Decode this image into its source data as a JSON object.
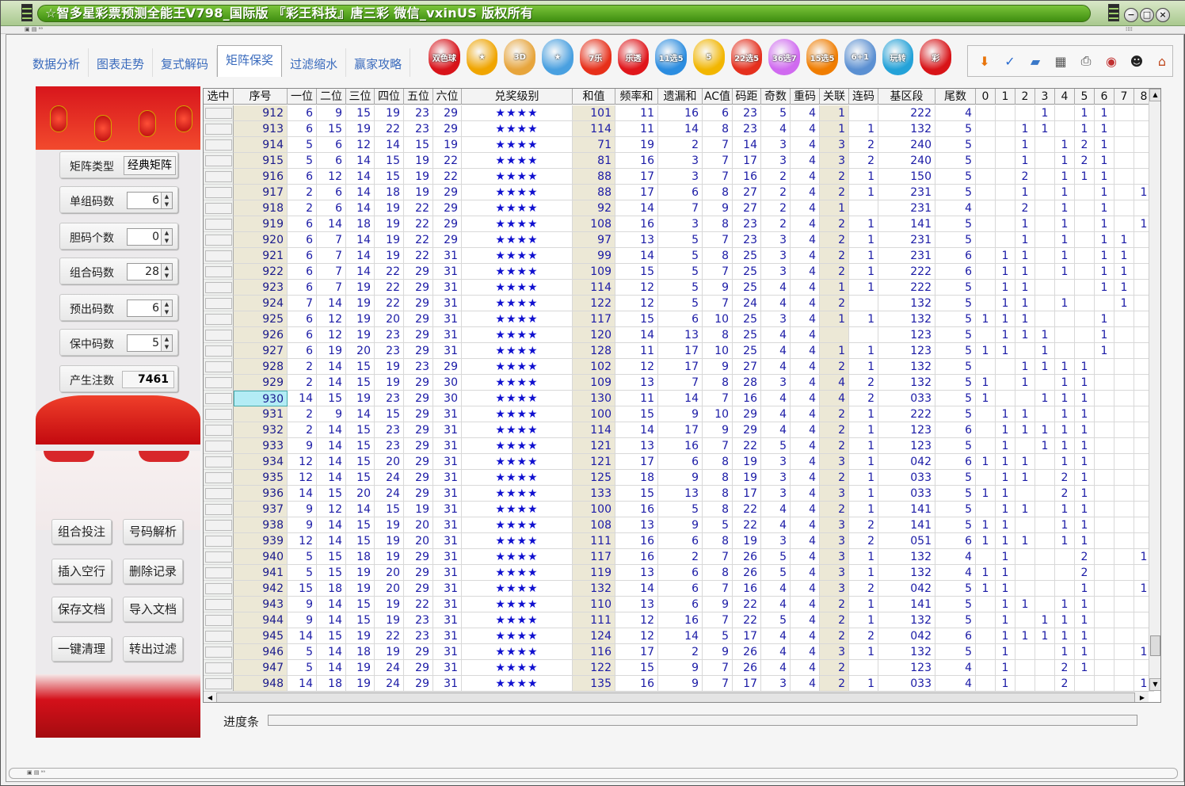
{
  "window": {
    "title": "☆智多星彩票预测全能王V798_国际版 『彩王科技』唐三彩 微信_vxinUS 版权所有",
    "min": "−",
    "max": "□",
    "close": "×",
    "mini_left": "▣ ▤ ᵃᵃ",
    "mini_right": "⁞⁞⁞⁞"
  },
  "tabs": [
    {
      "label": "数据分析"
    },
    {
      "label": "图表走势"
    },
    {
      "label": "复式解码"
    },
    {
      "label": "矩阵保奖",
      "active": true
    },
    {
      "label": "过滤缩水"
    },
    {
      "label": "赢家攻略"
    }
  ],
  "lottery_icons": [
    {
      "name": "shuangseqiu",
      "text": "双色球",
      "color": "#d8131a"
    },
    {
      "name": "qixingcai",
      "text": "★",
      "color": "#f0a500"
    },
    {
      "name": "fucai3d",
      "text": "3D",
      "color": "#e7a53c"
    },
    {
      "name": "pailie",
      "text": "★",
      "color": "#49a0e0"
    },
    {
      "name": "qilecai",
      "text": "7乐",
      "color": "#e7301a"
    },
    {
      "name": "daletou",
      "text": "乐透",
      "color": "#e0161b"
    },
    {
      "name": "11xuan5",
      "text": "11选5",
      "color": "#2c8de0"
    },
    {
      "name": "haocai5",
      "text": "5",
      "color": "#f2b600"
    },
    {
      "name": "22xuan5",
      "text": "22选5",
      "color": "#e5301e"
    },
    {
      "name": "36xuan7",
      "text": "36选7",
      "color": "#d06af0"
    },
    {
      "name": "15xuan5",
      "text": "15选5",
      "color": "#f07d00"
    },
    {
      "name": "6plus1",
      "text": "6+1",
      "color": "#5b90d2"
    },
    {
      "name": "huanle",
      "text": "玩转",
      "color": "#24a2d8"
    },
    {
      "name": "extra",
      "text": "彩",
      "color": "#d81418"
    }
  ],
  "tools": [
    "down-arrow",
    "abc-check",
    "save-folder",
    "calculator",
    "printer",
    "gumball",
    "qq-penguin",
    "home"
  ],
  "tool_glyphs": [
    "⬇",
    "✓",
    "▰",
    "▦",
    "⎙",
    "◉",
    "☻",
    "⌂"
  ],
  "left": {
    "matrix_type_label": "矩阵类型",
    "matrix_type_value": "经典矩阵",
    "group_count_label": "单组码数",
    "group_count_value": "6",
    "dan_count_label": "胆码个数",
    "dan_count_value": "0",
    "combo_count_label": "组合码数",
    "combo_count_value": "28",
    "predict_label": "预出码数",
    "predict_value": "6",
    "guarantee_label": "保中码数",
    "guarantee_value": "5",
    "output_label": "产生注数",
    "output_value": "7461",
    "buttons": [
      "组合投注",
      "号码解析",
      "插入空行",
      "删除记录",
      "保存文档",
      "导入文档",
      "一键清理",
      "转出过滤"
    ]
  },
  "grid": {
    "headers": [
      "选中",
      "序号",
      "一位",
      "二位",
      "三位",
      "四位",
      "五位",
      "六位",
      "兑奖级别",
      "和值",
      "频率和",
      "遗漏和",
      "AC值",
      "码距",
      "奇数",
      "重码",
      "关联",
      "连码",
      "基区段",
      "尾数",
      "0",
      "1",
      "2",
      "3",
      "4",
      "5",
      "6",
      "7",
      "8"
    ],
    "stars": "★★★★",
    "highlight_seq": "930",
    "rows": [
      [
        "912",
        "6",
        "9",
        "15",
        "19",
        "23",
        "29",
        "101",
        "11",
        "16",
        "6",
        "23",
        "5",
        "4",
        "1",
        "",
        "222",
        "4",
        "",
        "",
        "",
        "1",
        "",
        "1",
        "1",
        "",
        ""
      ],
      [
        "913",
        "6",
        "15",
        "19",
        "22",
        "23",
        "29",
        "114",
        "11",
        "14",
        "8",
        "23",
        "4",
        "4",
        "1",
        "1",
        "132",
        "5",
        "",
        "",
        "1",
        "1",
        "",
        "1",
        "1",
        "",
        ""
      ],
      [
        "914",
        "5",
        "6",
        "12",
        "14",
        "15",
        "19",
        "71",
        "19",
        "2",
        "7",
        "14",
        "3",
        "4",
        "3",
        "2",
        "240",
        "5",
        "",
        "",
        "1",
        "",
        "1",
        "2",
        "1",
        "",
        ""
      ],
      [
        "915",
        "5",
        "6",
        "14",
        "15",
        "19",
        "22",
        "81",
        "16",
        "3",
        "7",
        "17",
        "3",
        "4",
        "3",
        "2",
        "240",
        "5",
        "",
        "",
        "1",
        "",
        "1",
        "2",
        "1",
        "",
        ""
      ],
      [
        "916",
        "6",
        "12",
        "14",
        "15",
        "19",
        "22",
        "88",
        "17",
        "3",
        "7",
        "16",
        "2",
        "4",
        "2",
        "1",
        "150",
        "5",
        "",
        "",
        "2",
        "",
        "1",
        "1",
        "1",
        "",
        ""
      ],
      [
        "917",
        "2",
        "6",
        "14",
        "18",
        "19",
        "29",
        "88",
        "17",
        "6",
        "8",
        "27",
        "2",
        "4",
        "2",
        "1",
        "231",
        "5",
        "",
        "",
        "1",
        "",
        "1",
        "",
        "1",
        "",
        "1"
      ],
      [
        "918",
        "2",
        "6",
        "14",
        "19",
        "22",
        "29",
        "92",
        "14",
        "7",
        "9",
        "27",
        "2",
        "4",
        "1",
        "",
        "231",
        "4",
        "",
        "",
        "2",
        "",
        "1",
        "",
        "1",
        "",
        ""
      ],
      [
        "919",
        "6",
        "14",
        "18",
        "19",
        "22",
        "29",
        "108",
        "16",
        "3",
        "8",
        "23",
        "2",
        "4",
        "2",
        "1",
        "141",
        "5",
        "",
        "",
        "1",
        "",
        "1",
        "",
        "1",
        "",
        "1"
      ],
      [
        "920",
        "6",
        "7",
        "14",
        "19",
        "22",
        "29",
        "97",
        "13",
        "5",
        "7",
        "23",
        "3",
        "4",
        "2",
        "1",
        "231",
        "5",
        "",
        "",
        "1",
        "",
        "1",
        "",
        "1",
        "1",
        ""
      ],
      [
        "921",
        "6",
        "7",
        "14",
        "19",
        "22",
        "31",
        "99",
        "14",
        "5",
        "8",
        "25",
        "3",
        "4",
        "2",
        "1",
        "231",
        "6",
        "",
        "1",
        "1",
        "",
        "1",
        "",
        "1",
        "1",
        ""
      ],
      [
        "922",
        "6",
        "7",
        "14",
        "22",
        "29",
        "31",
        "109",
        "15",
        "5",
        "7",
        "25",
        "3",
        "4",
        "2",
        "1",
        "222",
        "6",
        "",
        "1",
        "1",
        "",
        "1",
        "",
        "1",
        "1",
        ""
      ],
      [
        "923",
        "6",
        "7",
        "19",
        "22",
        "29",
        "31",
        "114",
        "12",
        "5",
        "9",
        "25",
        "4",
        "4",
        "1",
        "1",
        "222",
        "5",
        "",
        "1",
        "1",
        "",
        "",
        "",
        "1",
        "1",
        ""
      ],
      [
        "924",
        "7",
        "14",
        "19",
        "22",
        "29",
        "31",
        "122",
        "12",
        "5",
        "7",
        "24",
        "4",
        "4",
        "2",
        "",
        "132",
        "5",
        "",
        "1",
        "1",
        "",
        "1",
        "",
        "",
        "1",
        ""
      ],
      [
        "925",
        "6",
        "12",
        "19",
        "20",
        "29",
        "31",
        "117",
        "15",
        "6",
        "10",
        "25",
        "3",
        "4",
        "1",
        "1",
        "132",
        "5",
        "1",
        "1",
        "1",
        "",
        "",
        "",
        "1",
        "",
        ""
      ],
      [
        "926",
        "6",
        "12",
        "19",
        "23",
        "29",
        "31",
        "120",
        "14",
        "13",
        "8",
        "25",
        "4",
        "4",
        "",
        "",
        "123",
        "5",
        "",
        "1",
        "1",
        "1",
        "",
        "",
        "1",
        "",
        ""
      ],
      [
        "927",
        "6",
        "19",
        "20",
        "23",
        "29",
        "31",
        "128",
        "11",
        "17",
        "10",
        "25",
        "4",
        "4",
        "1",
        "1",
        "123",
        "5",
        "1",
        "1",
        "",
        "1",
        "",
        "",
        "1",
        "",
        ""
      ],
      [
        "928",
        "2",
        "14",
        "15",
        "19",
        "23",
        "29",
        "102",
        "12",
        "17",
        "9",
        "27",
        "4",
        "4",
        "2",
        "1",
        "132",
        "5",
        "",
        "",
        "1",
        "1",
        "1",
        "1",
        "",
        "",
        ""
      ],
      [
        "929",
        "2",
        "14",
        "15",
        "19",
        "29",
        "30",
        "109",
        "13",
        "7",
        "8",
        "28",
        "3",
        "4",
        "4",
        "2",
        "132",
        "5",
        "1",
        "",
        "1",
        "",
        "1",
        "1",
        "",
        "",
        ""
      ],
      [
        "930",
        "14",
        "15",
        "19",
        "23",
        "29",
        "30",
        "130",
        "11",
        "14",
        "7",
        "16",
        "4",
        "4",
        "4",
        "2",
        "033",
        "5",
        "1",
        "",
        "",
        "1",
        "1",
        "1",
        "",
        "",
        ""
      ],
      [
        "931",
        "2",
        "9",
        "14",
        "15",
        "29",
        "31",
        "100",
        "15",
        "9",
        "10",
        "29",
        "4",
        "4",
        "2",
        "1",
        "222",
        "5",
        "",
        "1",
        "1",
        "",
        "1",
        "1",
        "",
        "",
        ""
      ],
      [
        "932",
        "2",
        "14",
        "15",
        "23",
        "29",
        "31",
        "114",
        "14",
        "17",
        "9",
        "29",
        "4",
        "4",
        "2",
        "1",
        "123",
        "6",
        "",
        "1",
        "1",
        "1",
        "1",
        "1",
        "",
        "",
        ""
      ],
      [
        "933",
        "9",
        "14",
        "15",
        "23",
        "29",
        "31",
        "121",
        "13",
        "16",
        "7",
        "22",
        "5",
        "4",
        "2",
        "1",
        "123",
        "5",
        "",
        "1",
        "",
        "1",
        "1",
        "1",
        "",
        "",
        ""
      ],
      [
        "934",
        "12",
        "14",
        "15",
        "20",
        "29",
        "31",
        "121",
        "17",
        "6",
        "8",
        "19",
        "3",
        "4",
        "3",
        "1",
        "042",
        "6",
        "1",
        "1",
        "1",
        "",
        "1",
        "1",
        "",
        "",
        ""
      ],
      [
        "935",
        "12",
        "14",
        "15",
        "24",
        "29",
        "31",
        "125",
        "18",
        "9",
        "8",
        "19",
        "3",
        "4",
        "2",
        "1",
        "033",
        "5",
        "",
        "1",
        "1",
        "",
        "2",
        "1",
        "",
        "",
        ""
      ],
      [
        "936",
        "14",
        "15",
        "20",
        "24",
        "29",
        "31",
        "133",
        "15",
        "13",
        "8",
        "17",
        "3",
        "4",
        "3",
        "1",
        "033",
        "5",
        "1",
        "1",
        "",
        "",
        "2",
        "1",
        "",
        "",
        ""
      ],
      [
        "937",
        "9",
        "12",
        "14",
        "15",
        "19",
        "31",
        "100",
        "16",
        "5",
        "8",
        "22",
        "4",
        "4",
        "2",
        "1",
        "141",
        "5",
        "",
        "1",
        "1",
        "",
        "1",
        "1",
        "",
        "",
        ""
      ],
      [
        "938",
        "9",
        "14",
        "15",
        "19",
        "20",
        "31",
        "108",
        "13",
        "9",
        "5",
        "22",
        "4",
        "4",
        "3",
        "2",
        "141",
        "5",
        "1",
        "1",
        "",
        "",
        "1",
        "1",
        "",
        "",
        ""
      ],
      [
        "939",
        "12",
        "14",
        "15",
        "19",
        "20",
        "31",
        "111",
        "16",
        "6",
        "8",
        "19",
        "3",
        "4",
        "3",
        "2",
        "051",
        "6",
        "1",
        "1",
        "1",
        "",
        "1",
        "1",
        "",
        "",
        ""
      ],
      [
        "940",
        "5",
        "15",
        "18",
        "19",
        "29",
        "31",
        "117",
        "16",
        "2",
        "7",
        "26",
        "5",
        "4",
        "3",
        "1",
        "132",
        "4",
        "",
        "1",
        "",
        "",
        "",
        "2",
        "",
        "",
        "1"
      ],
      [
        "941",
        "5",
        "15",
        "19",
        "20",
        "29",
        "31",
        "119",
        "13",
        "6",
        "8",
        "26",
        "5",
        "4",
        "3",
        "1",
        "132",
        "4",
        "1",
        "1",
        "",
        "",
        "",
        "2",
        "",
        "",
        ""
      ],
      [
        "942",
        "15",
        "18",
        "19",
        "20",
        "29",
        "31",
        "132",
        "14",
        "6",
        "7",
        "16",
        "4",
        "4",
        "3",
        "2",
        "042",
        "5",
        "1",
        "1",
        "",
        "",
        "",
        "1",
        "",
        "",
        "1"
      ],
      [
        "943",
        "9",
        "14",
        "15",
        "19",
        "22",
        "31",
        "110",
        "13",
        "6",
        "9",
        "22",
        "4",
        "4",
        "2",
        "1",
        "141",
        "5",
        "",
        "1",
        "1",
        "",
        "1",
        "1",
        "",
        "",
        ""
      ],
      [
        "944",
        "9",
        "14",
        "15",
        "19",
        "23",
        "31",
        "111",
        "12",
        "16",
        "7",
        "22",
        "5",
        "4",
        "2",
        "1",
        "132",
        "5",
        "",
        "1",
        "",
        "1",
        "1",
        "1",
        "",
        "",
        ""
      ],
      [
        "945",
        "14",
        "15",
        "19",
        "22",
        "23",
        "31",
        "124",
        "12",
        "14",
        "5",
        "17",
        "4",
        "4",
        "2",
        "2",
        "042",
        "6",
        "",
        "1",
        "1",
        "1",
        "1",
        "1",
        "",
        "",
        ""
      ],
      [
        "946",
        "5",
        "14",
        "18",
        "19",
        "29",
        "31",
        "116",
        "17",
        "2",
        "9",
        "26",
        "4",
        "4",
        "3",
        "1",
        "132",
        "5",
        "",
        "1",
        "",
        "",
        "1",
        "1",
        "",
        "",
        "1"
      ],
      [
        "947",
        "5",
        "14",
        "19",
        "24",
        "29",
        "31",
        "122",
        "15",
        "9",
        "7",
        "26",
        "4",
        "4",
        "2",
        "",
        "123",
        "4",
        "",
        "1",
        "",
        "",
        "2",
        "1",
        "",
        "",
        ""
      ],
      [
        "948",
        "14",
        "18",
        "19",
        "24",
        "29",
        "31",
        "135",
        "16",
        "9",
        "7",
        "17",
        "3",
        "4",
        "2",
        "1",
        "033",
        "4",
        "",
        "1",
        "",
        "",
        "2",
        "",
        "",
        "",
        "1"
      ]
    ]
  },
  "progress_label": "进度条"
}
